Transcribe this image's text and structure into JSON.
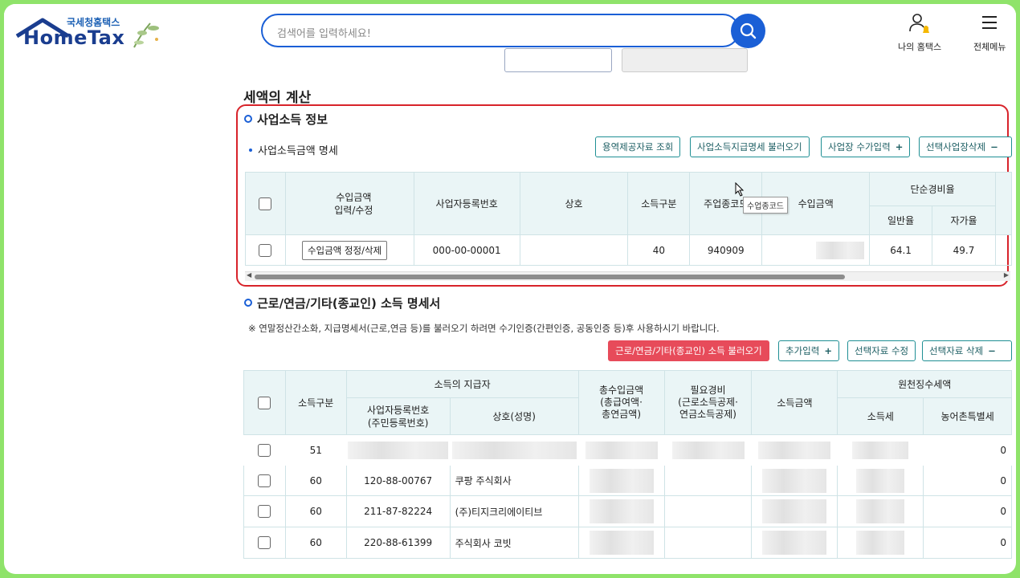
{
  "header": {
    "logo_small": "국세청홈택스",
    "logo_big": "HomeTax",
    "search_placeholder": "검색어를 입력하세요!",
    "my_hometax": "나의 홈택스",
    "all_menu": "전체메뉴"
  },
  "page": {
    "section_title": "세액의 계산"
  },
  "business": {
    "title": "사업소득 정보",
    "subtitle": "사업소득금액 명세",
    "buttons": {
      "service_lookup": "용역제공자료 조회",
      "load_statement": "사업소득지급명세 불러오기",
      "manual_input": "사업장 수가입력",
      "delete_selected": "선택사업장삭제"
    },
    "columns": {
      "amount_edit": "수입금액\n입력/수정",
      "reg_no": "사업자등록번호",
      "name": "상호",
      "income_type": "소득구분",
      "industry_code": "주업종코드",
      "revenue": "수입금액",
      "simple_rate": "단순경비율",
      "general_rate": "일반율",
      "own_rate": "자가율"
    },
    "tooltip": "수업종코드",
    "row": {
      "edit_button": "수입금액 정정/삭제",
      "reg_no": "000-00-00001",
      "name": "",
      "income_type": "40",
      "industry_code": "940909",
      "general_rate": "64.1",
      "own_rate": "49.7"
    }
  },
  "labor": {
    "title": "근로/연금/기타(종교인) 소득 명세서",
    "notice": "※ 연말정산간소화, 지급명세서(근로,연금 등)를 불러오기 하려면 수기인증(간편인증, 공동인증 등)후 사용하시기 바랍니다.",
    "buttons": {
      "load": "근로/연금/기타(종교인) 소득 불러오기",
      "add": "추가입력",
      "edit": "선택자료 수정",
      "delete": "선택자료 삭제"
    },
    "columns": {
      "income_type": "소득구분",
      "payer": "소득의 지급자",
      "reg_no": "사업자등록번호\n(주민등록번호)",
      "name": "상호(성명)",
      "total_income": "총수입금액\n(총급여액·\n총연금액)",
      "expense": "필요경비\n(근로소득공제·\n연금소득공제)",
      "income_amount": "소득금액",
      "withholding": "원천징수세액",
      "income_tax": "소득세",
      "rural_tax": "농어촌특별세"
    },
    "rows": [
      {
        "income_type": "51",
        "reg_no": "",
        "name": "",
        "rural_tax": "0"
      },
      {
        "income_type": "60",
        "reg_no": "120-88-00767",
        "name": "쿠팡 주식회사",
        "rural_tax": "0"
      },
      {
        "income_type": "60",
        "reg_no": "211-87-82224",
        "name": "(주)티지크리에이티브",
        "rural_tax": "0"
      },
      {
        "income_type": "60",
        "reg_no": "220-88-61399",
        "name": "주식회사 코빗",
        "rural_tax": "0"
      }
    ]
  },
  "colors": {
    "primary": "#1a5fd6",
    "highlight_border": "#d8232a",
    "red_button": "#e74b5a",
    "table_header": "#eaf5f6"
  }
}
